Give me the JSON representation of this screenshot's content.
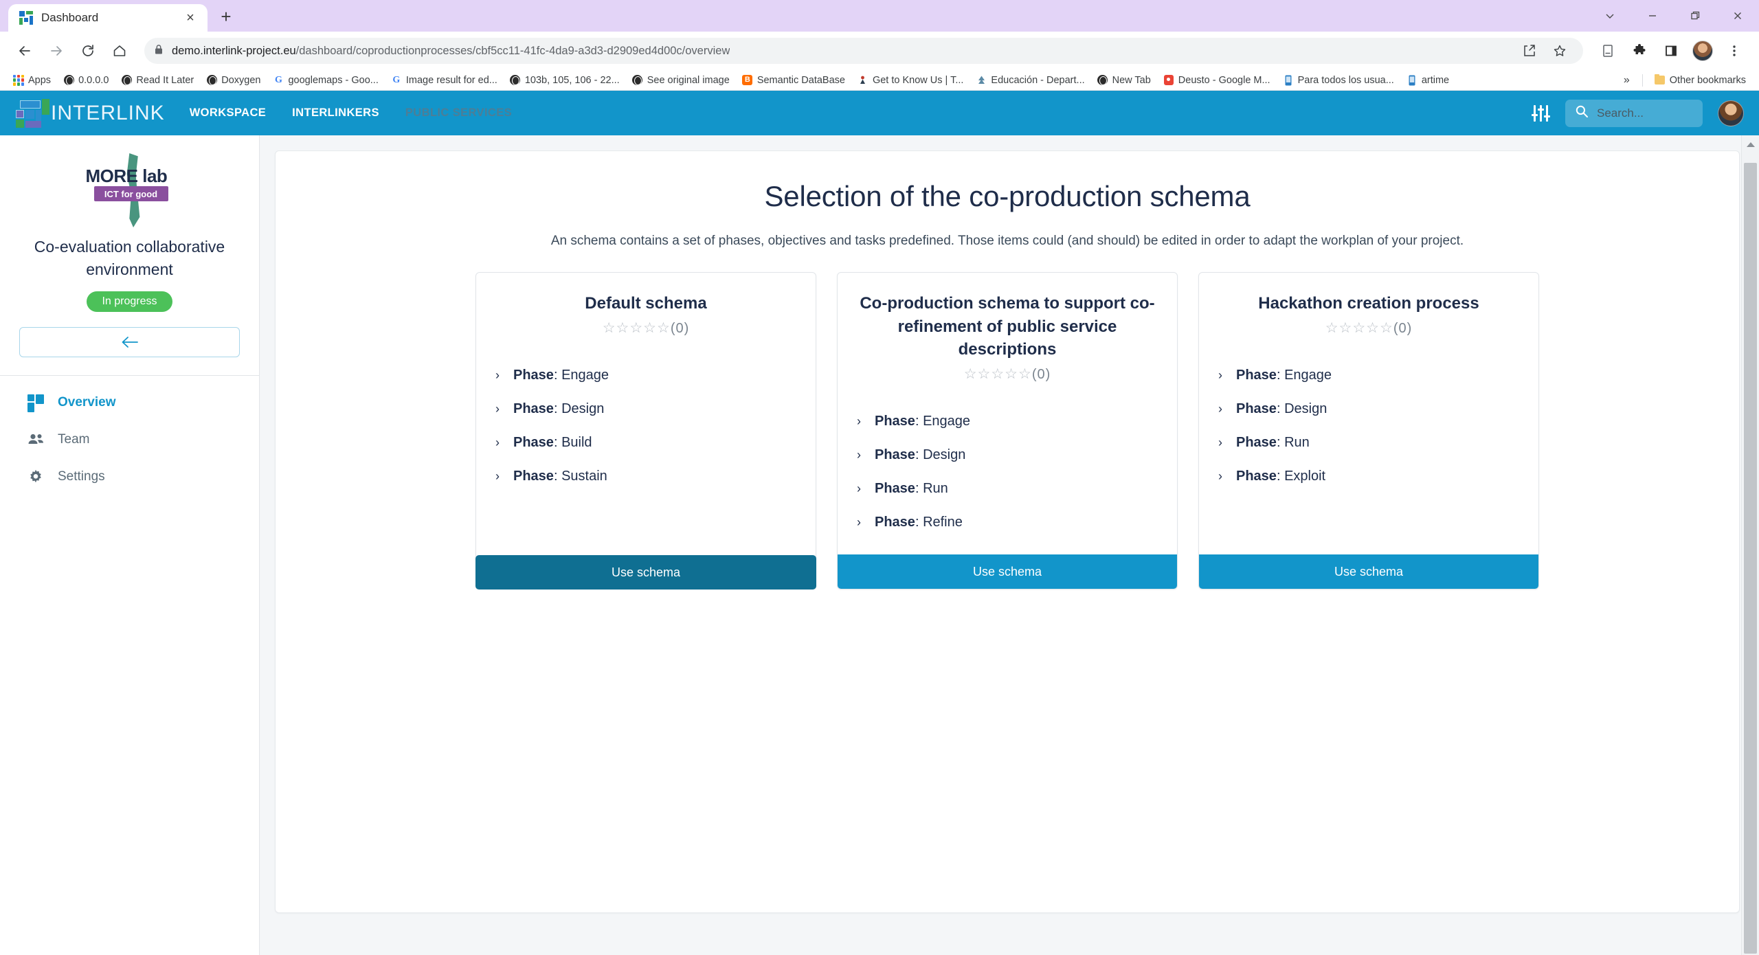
{
  "browser": {
    "tab": {
      "title": "Dashboard",
      "favicon": "dashboard-favicon",
      "close_label": "×"
    },
    "new_tab_label": "+",
    "window_controls": {
      "list": "tab-search-chevron",
      "minimize": "minimize",
      "maximize": "maximize",
      "close": "close"
    },
    "nav": {
      "back": "back-arrow",
      "forward": "forward-arrow",
      "reload": "reload",
      "home": "home"
    },
    "omnibox": {
      "lock": "lock-icon",
      "url_domain": "demo.interlink-project.eu",
      "url_path": "/dashboard/coproductionprocesses/cbf5cc11-41fc-4da9-a3d3-d2909ed4d00c/overview",
      "share_icon": "share-icon",
      "bookmark_icon": "star-icon"
    },
    "toolbar_icons": [
      "reading-list-icon",
      "extensions-puzzle-icon",
      "side-panel-icon",
      "profile-avatar",
      "chrome-menu-icon"
    ],
    "bookmarks": [
      {
        "label": "Apps",
        "icon": "apps-grid-icon"
      },
      {
        "label": "0.0.0.0",
        "icon": "globe-icon"
      },
      {
        "label": "Read It Later",
        "icon": "globe-icon"
      },
      {
        "label": "Doxygen",
        "icon": "globe-icon"
      },
      {
        "label": "googlemaps - Goo...",
        "icon": "google-icon"
      },
      {
        "label": "Image result for ed...",
        "icon": "google-icon"
      },
      {
        "label": "103b, 105, 106 - 22...",
        "icon": "globe-icon"
      },
      {
        "label": "See original image",
        "icon": "globe-icon"
      },
      {
        "label": "Semantic DataBase",
        "icon": "blogger-icon"
      },
      {
        "label": "Get to Know Us | T...",
        "icon": "site-icon"
      },
      {
        "label": "Educación - Depart...",
        "icon": "site-icon"
      },
      {
        "label": "New Tab",
        "icon": "globe-icon"
      },
      {
        "label": "Deusto - Google M...",
        "icon": "maps-pin-icon"
      },
      {
        "label": "Para todos los usua...",
        "icon": "phone-icon"
      },
      {
        "label": "artime",
        "icon": "phone-icon"
      }
    ],
    "bookmarks_overflow": "»",
    "other_bookmarks": {
      "label": "Other bookmarks",
      "icon": "folder-icon"
    }
  },
  "app": {
    "brand": {
      "name": "INTERLINK",
      "mark": "interlink-logo"
    },
    "nav": [
      {
        "label": "WORKSPACE",
        "state": "active"
      },
      {
        "label": "INTERLINKERS",
        "state": "active"
      },
      {
        "label": "PUBLIC SERVICES",
        "state": "muted"
      }
    ],
    "settings_icon": "sliders-icon",
    "search": {
      "placeholder": "Search...",
      "value": "",
      "icon": "search-icon"
    },
    "user_avatar": "user-avatar",
    "accent_color": "#1295ca",
    "accent_dark_color": "#0f6f92"
  },
  "sidebar": {
    "logo": {
      "name": "morelab-logo",
      "text_main": "MORE lab",
      "text_sub": "ICT for good"
    },
    "project_title": "Co-evaluation collaborative environment",
    "status_badge": {
      "label": "In progress",
      "color": "#4cc159"
    },
    "back_button": "back-arrow-icon",
    "items": [
      {
        "label": "Overview",
        "icon": "dashboard-icon",
        "active": true
      },
      {
        "label": "Team",
        "icon": "people-icon",
        "active": false
      },
      {
        "label": "Settings",
        "icon": "gear-icon",
        "active": false
      }
    ]
  },
  "main": {
    "title": "Selection of the co-production schema",
    "subtitle": "An schema contains a set of phases, objectives and tasks predefined. Those items could (and should) be edited in order to adapt the workplan of your project.",
    "rating_stars": "☆☆☆☆☆",
    "phase_label": "Phase",
    "use_button_label": "Use schema",
    "cards": [
      {
        "title": "Default schema",
        "rating_count": "(0)",
        "phases": [
          "Engage",
          "Design",
          "Build",
          "Sustain"
        ],
        "button_state": "hover"
      },
      {
        "title": "Co-production schema to support co-refinement of public service descriptions",
        "rating_count": "(0)",
        "phases": [
          "Engage",
          "Design",
          "Run",
          "Refine"
        ],
        "button_state": "default"
      },
      {
        "title": "Hackathon creation process",
        "rating_count": "(0)",
        "phases": [
          "Engage",
          "Design",
          "Run",
          "Exploit"
        ],
        "button_state": "default"
      }
    ]
  }
}
